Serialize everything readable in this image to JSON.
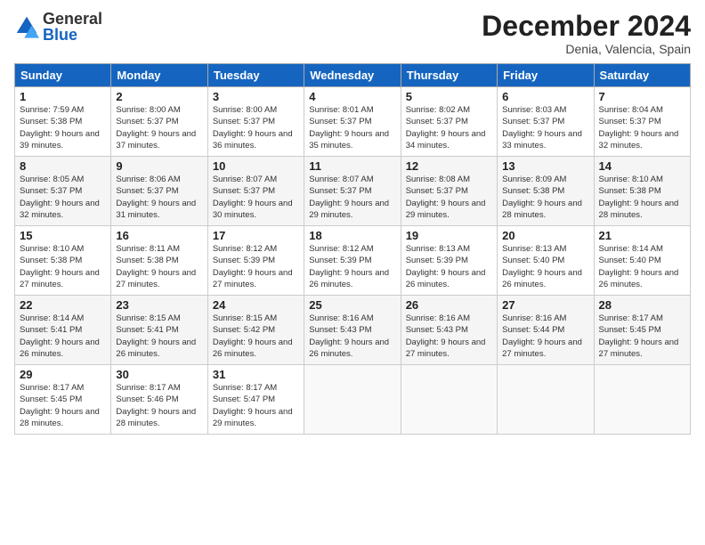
{
  "header": {
    "logo_general": "General",
    "logo_blue": "Blue",
    "month_title": "December 2024",
    "location": "Denia, Valencia, Spain"
  },
  "columns": [
    "Sunday",
    "Monday",
    "Tuesday",
    "Wednesday",
    "Thursday",
    "Friday",
    "Saturday"
  ],
  "weeks": [
    [
      {
        "day": "1",
        "sunrise": "7:59 AM",
        "sunset": "5:38 PM",
        "daylight": "9 hours and 39 minutes."
      },
      {
        "day": "2",
        "sunrise": "8:00 AM",
        "sunset": "5:37 PM",
        "daylight": "9 hours and 37 minutes."
      },
      {
        "day": "3",
        "sunrise": "8:00 AM",
        "sunset": "5:37 PM",
        "daylight": "9 hours and 36 minutes."
      },
      {
        "day": "4",
        "sunrise": "8:01 AM",
        "sunset": "5:37 PM",
        "daylight": "9 hours and 35 minutes."
      },
      {
        "day": "5",
        "sunrise": "8:02 AM",
        "sunset": "5:37 PM",
        "daylight": "9 hours and 34 minutes."
      },
      {
        "day": "6",
        "sunrise": "8:03 AM",
        "sunset": "5:37 PM",
        "daylight": "9 hours and 33 minutes."
      },
      {
        "day": "7",
        "sunrise": "8:04 AM",
        "sunset": "5:37 PM",
        "daylight": "9 hours and 32 minutes."
      }
    ],
    [
      {
        "day": "8",
        "sunrise": "8:05 AM",
        "sunset": "5:37 PM",
        "daylight": "9 hours and 32 minutes."
      },
      {
        "day": "9",
        "sunrise": "8:06 AM",
        "sunset": "5:37 PM",
        "daylight": "9 hours and 31 minutes."
      },
      {
        "day": "10",
        "sunrise": "8:07 AM",
        "sunset": "5:37 PM",
        "daylight": "9 hours and 30 minutes."
      },
      {
        "day": "11",
        "sunrise": "8:07 AM",
        "sunset": "5:37 PM",
        "daylight": "9 hours and 29 minutes."
      },
      {
        "day": "12",
        "sunrise": "8:08 AM",
        "sunset": "5:37 PM",
        "daylight": "9 hours and 29 minutes."
      },
      {
        "day": "13",
        "sunrise": "8:09 AM",
        "sunset": "5:38 PM",
        "daylight": "9 hours and 28 minutes."
      },
      {
        "day": "14",
        "sunrise": "8:10 AM",
        "sunset": "5:38 PM",
        "daylight": "9 hours and 28 minutes."
      }
    ],
    [
      {
        "day": "15",
        "sunrise": "8:10 AM",
        "sunset": "5:38 PM",
        "daylight": "9 hours and 27 minutes."
      },
      {
        "day": "16",
        "sunrise": "8:11 AM",
        "sunset": "5:38 PM",
        "daylight": "9 hours and 27 minutes."
      },
      {
        "day": "17",
        "sunrise": "8:12 AM",
        "sunset": "5:39 PM",
        "daylight": "9 hours and 27 minutes."
      },
      {
        "day": "18",
        "sunrise": "8:12 AM",
        "sunset": "5:39 PM",
        "daylight": "9 hours and 26 minutes."
      },
      {
        "day": "19",
        "sunrise": "8:13 AM",
        "sunset": "5:39 PM",
        "daylight": "9 hours and 26 minutes."
      },
      {
        "day": "20",
        "sunrise": "8:13 AM",
        "sunset": "5:40 PM",
        "daylight": "9 hours and 26 minutes."
      },
      {
        "day": "21",
        "sunrise": "8:14 AM",
        "sunset": "5:40 PM",
        "daylight": "9 hours and 26 minutes."
      }
    ],
    [
      {
        "day": "22",
        "sunrise": "8:14 AM",
        "sunset": "5:41 PM",
        "daylight": "9 hours and 26 minutes."
      },
      {
        "day": "23",
        "sunrise": "8:15 AM",
        "sunset": "5:41 PM",
        "daylight": "9 hours and 26 minutes."
      },
      {
        "day": "24",
        "sunrise": "8:15 AM",
        "sunset": "5:42 PM",
        "daylight": "9 hours and 26 minutes."
      },
      {
        "day": "25",
        "sunrise": "8:16 AM",
        "sunset": "5:43 PM",
        "daylight": "9 hours and 26 minutes."
      },
      {
        "day": "26",
        "sunrise": "8:16 AM",
        "sunset": "5:43 PM",
        "daylight": "9 hours and 27 minutes."
      },
      {
        "day": "27",
        "sunrise": "8:16 AM",
        "sunset": "5:44 PM",
        "daylight": "9 hours and 27 minutes."
      },
      {
        "day": "28",
        "sunrise": "8:17 AM",
        "sunset": "5:45 PM",
        "daylight": "9 hours and 27 minutes."
      }
    ],
    [
      {
        "day": "29",
        "sunrise": "8:17 AM",
        "sunset": "5:45 PM",
        "daylight": "9 hours and 28 minutes."
      },
      {
        "day": "30",
        "sunrise": "8:17 AM",
        "sunset": "5:46 PM",
        "daylight": "9 hours and 28 minutes."
      },
      {
        "day": "31",
        "sunrise": "8:17 AM",
        "sunset": "5:47 PM",
        "daylight": "9 hours and 29 minutes."
      },
      null,
      null,
      null,
      null
    ]
  ]
}
